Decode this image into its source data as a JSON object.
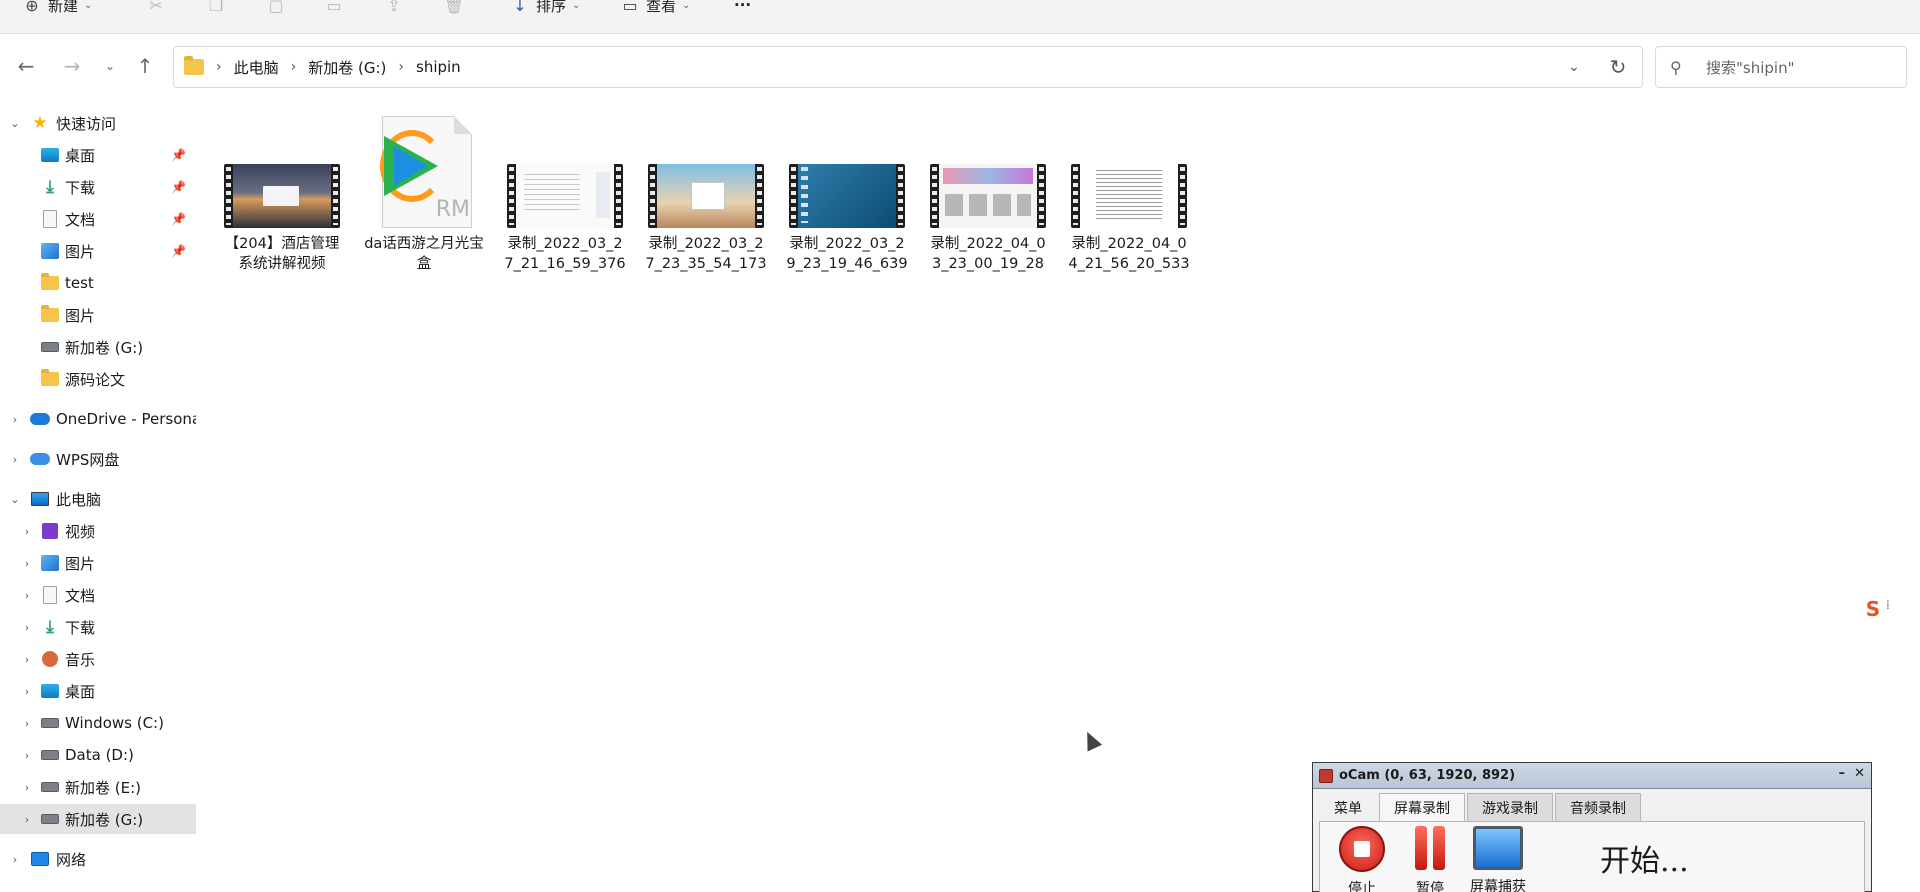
{
  "toolbar": {
    "new_label": "新建",
    "sort_label": "排序",
    "view_label": "查看",
    "more_label": "···"
  },
  "breadcrumb": [
    "此电脑",
    "新加卷 (G:)",
    "shipin"
  ],
  "search": {
    "placeholder": "搜索\"shipin\""
  },
  "nav": {
    "quick_access": "快速访问",
    "quick_items": [
      {
        "label": "桌面",
        "icon": "desktop-icon",
        "pinned": true
      },
      {
        "label": "下载",
        "icon": "download-icon",
        "pinned": true
      },
      {
        "label": "文档",
        "icon": "document-icon",
        "pinned": true
      },
      {
        "label": "图片",
        "icon": "pictures-icon",
        "pinned": true
      },
      {
        "label": "test",
        "icon": "folder-icon",
        "pinned": false
      },
      {
        "label": "图片",
        "icon": "folder-icon",
        "pinned": false
      },
      {
        "label": "新加卷 (G:)",
        "icon": "drive-icon",
        "pinned": false
      },
      {
        "label": "源码论文",
        "icon": "folder-icon",
        "pinned": false
      }
    ],
    "onedrive": "OneDrive - Persona",
    "wps": "WPS网盘",
    "this_pc": "此电脑",
    "pc_items": [
      {
        "label": "视频",
        "icon": "videos-icon"
      },
      {
        "label": "图片",
        "icon": "pictures-icon"
      },
      {
        "label": "文档",
        "icon": "document-icon"
      },
      {
        "label": "下载",
        "icon": "download-icon"
      },
      {
        "label": "音乐",
        "icon": "music-icon"
      },
      {
        "label": "桌面",
        "icon": "desktop-icon"
      },
      {
        "label": "Windows (C:)",
        "icon": "drive-icon"
      },
      {
        "label": "Data (D:)",
        "icon": "drive-icon"
      },
      {
        "label": "新加卷 (E:)",
        "icon": "drive-icon"
      },
      {
        "label": "新加卷 (G:)",
        "icon": "drive-icon",
        "selected": true
      }
    ],
    "network": "网络"
  },
  "files": [
    {
      "name": "【204】酒店管理系统讲解视频",
      "thumb": "hotel"
    },
    {
      "name": "da话西游之月光宝盒",
      "thumb": "rm"
    },
    {
      "name": "录制_2022_03_27_21_16_59_376",
      "thumb": "doc"
    },
    {
      "name": "录制_2022_03_27_23_35_54_173",
      "thumb": "resort"
    },
    {
      "name": "录制_2022_03_29_23_19_46_639",
      "thumb": "desk"
    },
    {
      "name": "录制_2022_04_03_23_00_19_28",
      "thumb": "web"
    },
    {
      "name": "录制_2022_04_04_21_56_20_533",
      "thumb": "text"
    }
  ],
  "rm_badge": "RM",
  "ocam": {
    "title": "oCam (0, 63, 1920, 892)",
    "tabs": [
      "菜单",
      "屏幕录制",
      "游戏录制",
      "音频录制"
    ],
    "active_tab": 1,
    "buttons": [
      "停止",
      "暂停",
      "屏幕捕获"
    ],
    "status": "开始..."
  }
}
